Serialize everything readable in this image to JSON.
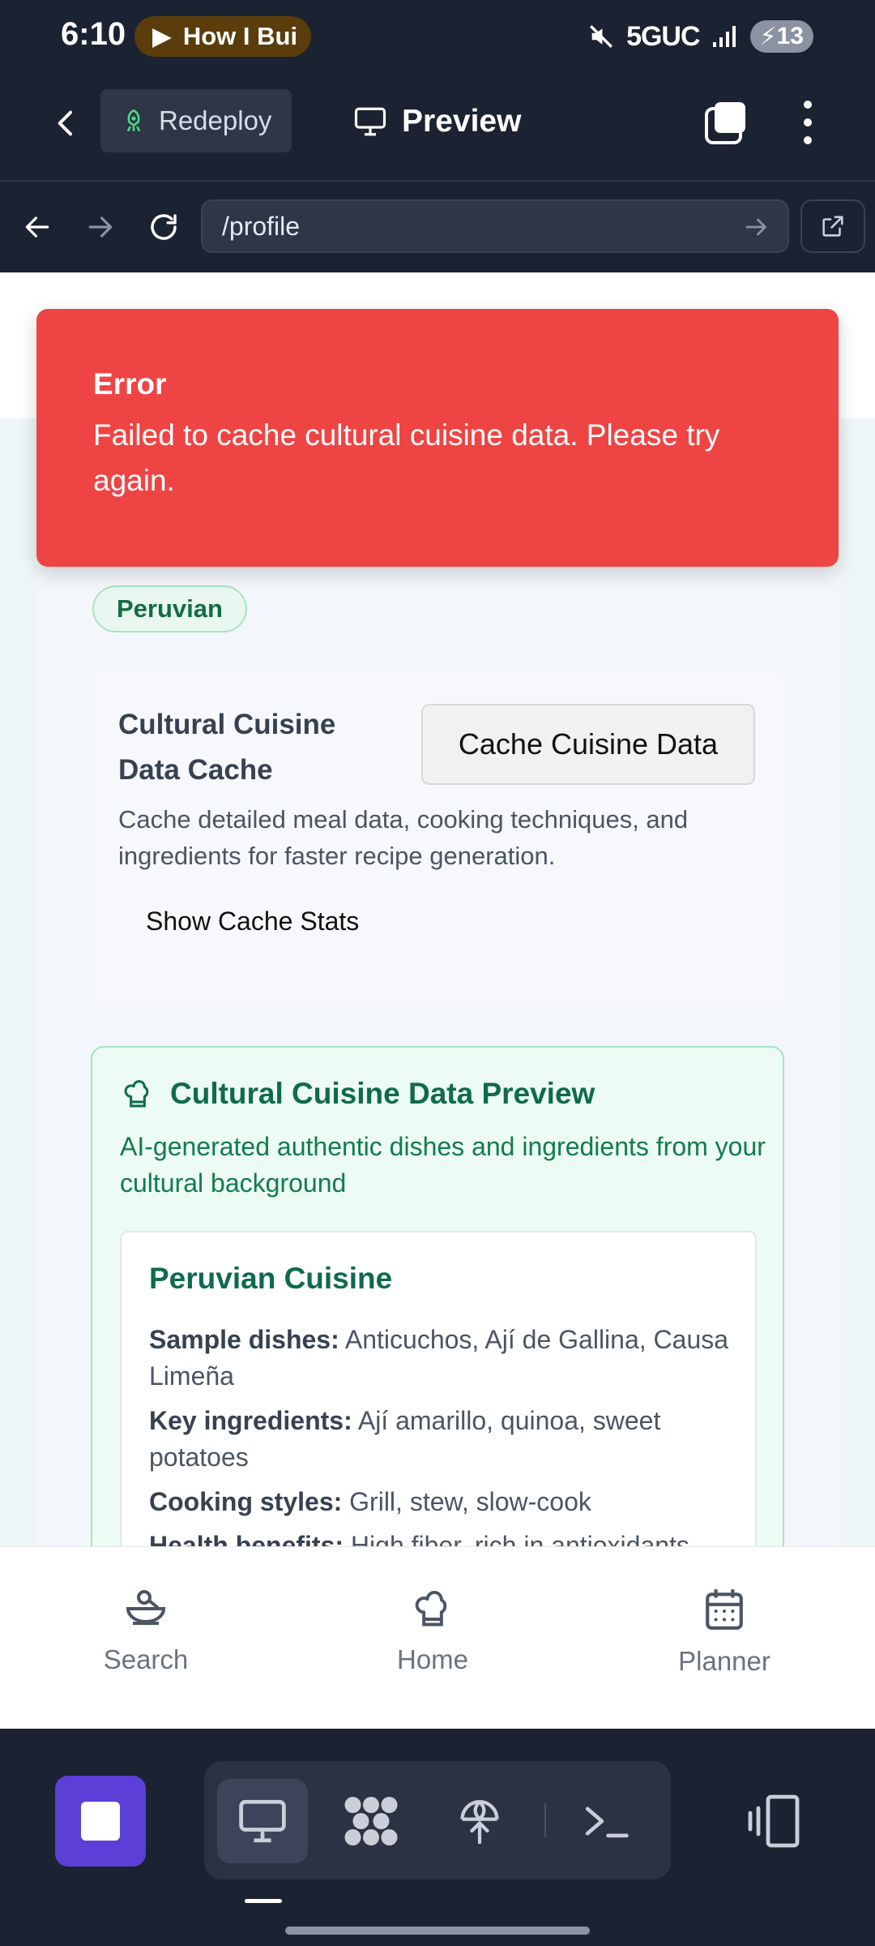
{
  "status_bar": {
    "time": "6:10",
    "media_label": "How I Bui",
    "network": "5GUC",
    "battery": "13"
  },
  "app_bar": {
    "redeploy_label": "Redeploy",
    "preview_label": "Preview"
  },
  "url_bar": {
    "url": "/profile"
  },
  "toast": {
    "title": "Error",
    "message": "Failed to cache cultural cuisine data. Please try again."
  },
  "profile": {
    "cuisine_chip": "Peruvian"
  },
  "cache_section": {
    "title": "Cultural Cuisine Data Cache",
    "button_label": "Cache Cuisine Data",
    "description": "Cache detailed meal data, cooking techniques, and ingredients for faster recipe generation.",
    "stats_button_label": "Show Cache Stats"
  },
  "preview_section": {
    "title": "Cultural Cuisine Data Preview",
    "subtitle": "AI-generated authentic dishes and ingredients from your cultural background",
    "card": {
      "title": "Peruvian Cuisine",
      "rows": [
        {
          "label": "Sample dishes:",
          "value": "Anticuchos, Ají de Gallina, Causa Limeña"
        },
        {
          "label": "Key ingredients:",
          "value": "Ají amarillo, quinoa, sweet potatoes"
        },
        {
          "label": "Cooking styles:",
          "value": "Grill, stew, slow-cook"
        },
        {
          "label": "Health benefits:",
          "value": "High fiber, rich in antioxidants"
        }
      ]
    }
  },
  "bottom_nav": {
    "items": [
      {
        "label": "Search",
        "icon": "bowl-search-icon"
      },
      {
        "label": "Home",
        "icon": "chef-hat-icon"
      },
      {
        "label": "Planner",
        "icon": "calendar-icon"
      }
    ]
  },
  "colors": {
    "error": "#ef4444",
    "accent_green": "#0f6b4a",
    "stop_button": "#5b3fd6",
    "chrome_bg": "#1b2232"
  }
}
